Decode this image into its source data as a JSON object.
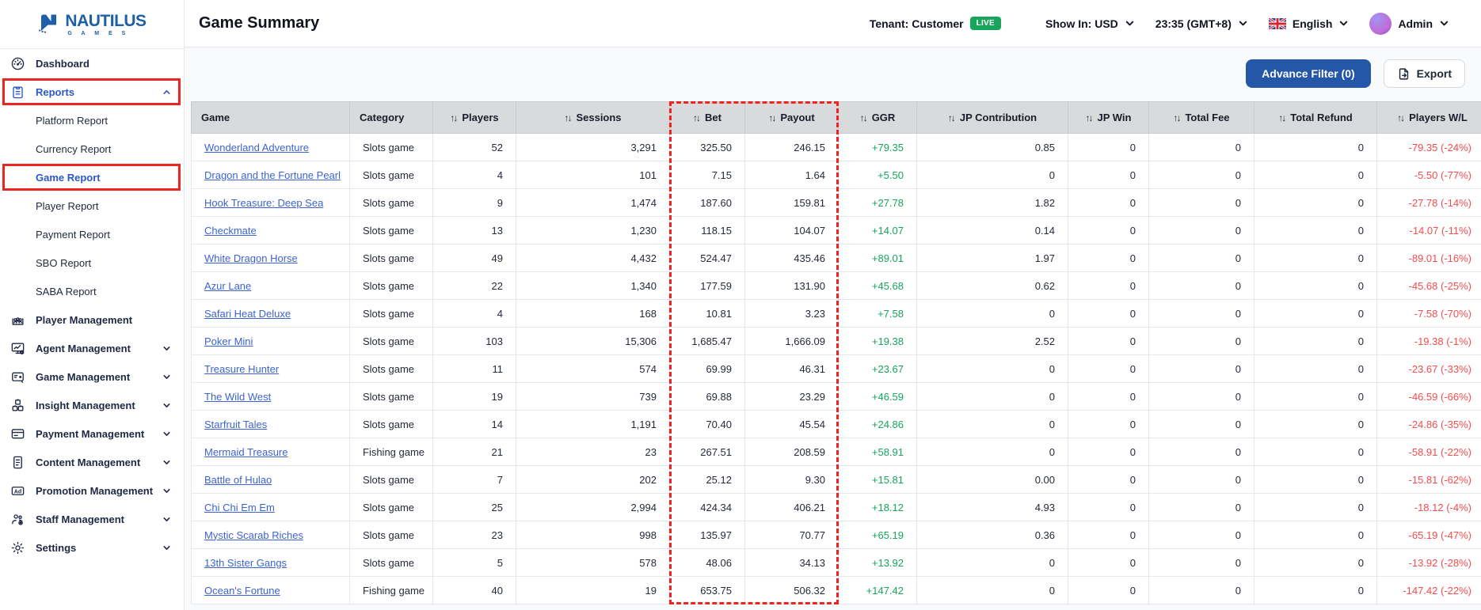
{
  "brand": {
    "name": "NAUTILUS",
    "sub": "G A M E S"
  },
  "header": {
    "title": "Game Summary",
    "tenant": "Tenant: Customer",
    "live": "LIVE",
    "show_in": "Show In: USD",
    "time": "23:35 (GMT+8)",
    "language": "English",
    "user": "Admin"
  },
  "toolbar": {
    "advance_filter": "Advance Filter (0)",
    "export": "Export"
  },
  "sidebar": [
    {
      "label": "Dashboard",
      "icon": "dashboard-icon"
    },
    {
      "label": "Reports",
      "icon": "reports-icon",
      "active": true,
      "annotated": true,
      "chevron": "up",
      "children": [
        {
          "label": "Platform Report"
        },
        {
          "label": "Currency Report"
        },
        {
          "label": "Game Report",
          "active": true,
          "annotated": true
        },
        {
          "label": "Player Report"
        },
        {
          "label": "Payment Report"
        },
        {
          "label": "SBO Report"
        },
        {
          "label": "SABA Report"
        }
      ]
    },
    {
      "label": "Player Management",
      "icon": "player-management-icon"
    },
    {
      "label": "Agent Management",
      "icon": "agent-management-icon",
      "chevron": "down"
    },
    {
      "label": "Game Management",
      "icon": "game-management-icon",
      "chevron": "down"
    },
    {
      "label": "Insight Management",
      "icon": "insight-management-icon",
      "chevron": "down"
    },
    {
      "label": "Payment Management",
      "icon": "payment-management-icon",
      "chevron": "down"
    },
    {
      "label": "Content Management",
      "icon": "content-management-icon",
      "chevron": "down"
    },
    {
      "label": "Promotion Management",
      "icon": "promotion-management-icon",
      "chevron": "down"
    },
    {
      "label": "Staff Management",
      "icon": "staff-management-icon",
      "chevron": "down"
    },
    {
      "label": "Settings",
      "icon": "settings-icon",
      "chevron": "down"
    }
  ],
  "table": {
    "columns": [
      {
        "label": "Game",
        "sortable": false
      },
      {
        "label": "Category",
        "sortable": false
      },
      {
        "label": "Players",
        "sortable": true
      },
      {
        "label": "Sessions",
        "sortable": true
      },
      {
        "label": "Bet",
        "sortable": true
      },
      {
        "label": "Payout",
        "sortable": true
      },
      {
        "label": "GGR",
        "sortable": true
      },
      {
        "label": "JP Contribution",
        "sortable": true
      },
      {
        "label": "JP Win",
        "sortable": true
      },
      {
        "label": "Total Fee",
        "sortable": true
      },
      {
        "label": "Total Refund",
        "sortable": true
      },
      {
        "label": "Players W/L",
        "sortable": true
      }
    ],
    "rows": [
      {
        "game": "Wonderland Adventure",
        "category": "Slots game",
        "players": "52",
        "sessions": "3,291",
        "bet": "325.50",
        "payout": "246.15",
        "ggr": "+79.35",
        "jp_contribution": "0.85",
        "jp_win": "0",
        "total_fee": "0",
        "total_refund": "0",
        "players_wl": "-79.35 (-24%)"
      },
      {
        "game": "Dragon and the Fortune Pearl",
        "category": "Slots game",
        "players": "4",
        "sessions": "101",
        "bet": "7.15",
        "payout": "1.64",
        "ggr": "+5.50",
        "jp_contribution": "0",
        "jp_win": "0",
        "total_fee": "0",
        "total_refund": "0",
        "players_wl": "-5.50 (-77%)"
      },
      {
        "game": "Hook Treasure: Deep Sea",
        "category": "Slots game",
        "players": "9",
        "sessions": "1,474",
        "bet": "187.60",
        "payout": "159.81",
        "ggr": "+27.78",
        "jp_contribution": "1.82",
        "jp_win": "0",
        "total_fee": "0",
        "total_refund": "0",
        "players_wl": "-27.78 (-14%)"
      },
      {
        "game": "Checkmate",
        "category": "Slots game",
        "players": "13",
        "sessions": "1,230",
        "bet": "118.15",
        "payout": "104.07",
        "ggr": "+14.07",
        "jp_contribution": "0.14",
        "jp_win": "0",
        "total_fee": "0",
        "total_refund": "0",
        "players_wl": "-14.07 (-11%)"
      },
      {
        "game": "White Dragon Horse",
        "category": "Slots game",
        "players": "49",
        "sessions": "4,432",
        "bet": "524.47",
        "payout": "435.46",
        "ggr": "+89.01",
        "jp_contribution": "1.97",
        "jp_win": "0",
        "total_fee": "0",
        "total_refund": "0",
        "players_wl": "-89.01 (-16%)"
      },
      {
        "game": "Azur Lane",
        "category": "Slots game",
        "players": "22",
        "sessions": "1,340",
        "bet": "177.59",
        "payout": "131.90",
        "ggr": "+45.68",
        "jp_contribution": "0.62",
        "jp_win": "0",
        "total_fee": "0",
        "total_refund": "0",
        "players_wl": "-45.68 (-25%)"
      },
      {
        "game": "Safari Heat Deluxe",
        "category": "Slots game",
        "players": "4",
        "sessions": "168",
        "bet": "10.81",
        "payout": "3.23",
        "ggr": "+7.58",
        "jp_contribution": "0",
        "jp_win": "0",
        "total_fee": "0",
        "total_refund": "0",
        "players_wl": "-7.58 (-70%)"
      },
      {
        "game": "Poker Mini",
        "category": "Slots game",
        "players": "103",
        "sessions": "15,306",
        "bet": "1,685.47",
        "payout": "1,666.09",
        "ggr": "+19.38",
        "jp_contribution": "2.52",
        "jp_win": "0",
        "total_fee": "0",
        "total_refund": "0",
        "players_wl": "-19.38 (-1%)"
      },
      {
        "game": "Treasure Hunter",
        "category": "Slots game",
        "players": "11",
        "sessions": "574",
        "bet": "69.99",
        "payout": "46.31",
        "ggr": "+23.67",
        "jp_contribution": "0",
        "jp_win": "0",
        "total_fee": "0",
        "total_refund": "0",
        "players_wl": "-23.67 (-33%)"
      },
      {
        "game": "The Wild West",
        "category": "Slots game",
        "players": "19",
        "sessions": "739",
        "bet": "69.88",
        "payout": "23.29",
        "ggr": "+46.59",
        "jp_contribution": "0",
        "jp_win": "0",
        "total_fee": "0",
        "total_refund": "0",
        "players_wl": "-46.59 (-66%)"
      },
      {
        "game": "Starfruit Tales",
        "category": "Slots game",
        "players": "14",
        "sessions": "1,191",
        "bet": "70.40",
        "payout": "45.54",
        "ggr": "+24.86",
        "jp_contribution": "0",
        "jp_win": "0",
        "total_fee": "0",
        "total_refund": "0",
        "players_wl": "-24.86 (-35%)"
      },
      {
        "game": "Mermaid Treasure",
        "category": "Fishing game",
        "players": "21",
        "sessions": "23",
        "bet": "267.51",
        "payout": "208.59",
        "ggr": "+58.91",
        "jp_contribution": "0",
        "jp_win": "0",
        "total_fee": "0",
        "total_refund": "0",
        "players_wl": "-58.91 (-22%)"
      },
      {
        "game": "Battle of Hulao",
        "category": "Slots game",
        "players": "7",
        "sessions": "202",
        "bet": "25.12",
        "payout": "9.30",
        "ggr": "+15.81",
        "jp_contribution": "0.00",
        "jp_win": "0",
        "total_fee": "0",
        "total_refund": "0",
        "players_wl": "-15.81 (-62%)"
      },
      {
        "game": "Chi Chi Em Em",
        "category": "Slots game",
        "players": "25",
        "sessions": "2,994",
        "bet": "424.34",
        "payout": "406.21",
        "ggr": "+18.12",
        "jp_contribution": "4.93",
        "jp_win": "0",
        "total_fee": "0",
        "total_refund": "0",
        "players_wl": "-18.12 (-4%)"
      },
      {
        "game": "Mystic Scarab Riches",
        "category": "Slots game",
        "players": "23",
        "sessions": "998",
        "bet": "135.97",
        "payout": "70.77",
        "ggr": "+65.19",
        "jp_contribution": "0.36",
        "jp_win": "0",
        "total_fee": "0",
        "total_refund": "0",
        "players_wl": "-65.19 (-47%)"
      },
      {
        "game": "13th Sister Gangs",
        "category": "Slots game",
        "players": "5",
        "sessions": "578",
        "bet": "48.06",
        "payout": "34.13",
        "ggr": "+13.92",
        "jp_contribution": "0",
        "jp_win": "0",
        "total_fee": "0",
        "total_refund": "0",
        "players_wl": "-13.92 (-28%)"
      },
      {
        "game": "Ocean's Fortune",
        "category": "Fishing game",
        "players": "40",
        "sessions": "19",
        "bet": "653.75",
        "payout": "506.32",
        "ggr": "+147.42",
        "jp_contribution": "0",
        "jp_win": "0",
        "total_fee": "0",
        "total_refund": "0",
        "players_wl": "-147.42 (-22%)"
      }
    ]
  },
  "colors": {
    "brand_blue": "#1d5fa8",
    "active_blue": "#2a58c8",
    "link_blue": "#3d63d2",
    "positive_green": "#17a45b",
    "negative_red": "#f74c4c",
    "annotation_red": "#ee2420",
    "button_blue": "#2457a8",
    "live_badge_green": "#17a45b",
    "table_header_gray": "#d9dadc"
  }
}
